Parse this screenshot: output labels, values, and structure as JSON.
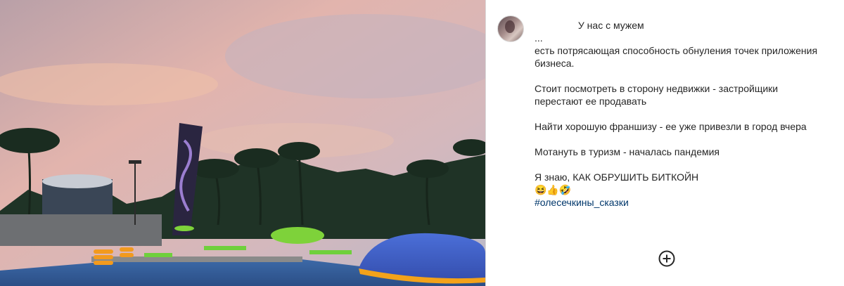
{
  "post": {
    "caption_head": "У нас с мужем",
    "caption_lines": [
      "...",
      "есть потрясающая способность обнуления точек приложения",
      "бизнеса.",
      "",
      "Стоит посмотреть в сторону недвижки - застройщики",
      "перестают ее продавать",
      "",
      "Найти хорошую франшизу - ее уже привезли в город вчера",
      "",
      "Мотануть в туризм - началась пандемия",
      "",
      "Я знаю, КАК ОБРУШИТЬ БИТКОЙН"
    ],
    "emojis": "😆👍🤣",
    "hashtag": "#олесечкины_сказки"
  },
  "icons": {
    "add": "plus-circle-icon",
    "avatar": "user-avatar"
  },
  "colors": {
    "text": "#262626",
    "hashtag": "#00376b",
    "border": "#dbdbdb"
  }
}
